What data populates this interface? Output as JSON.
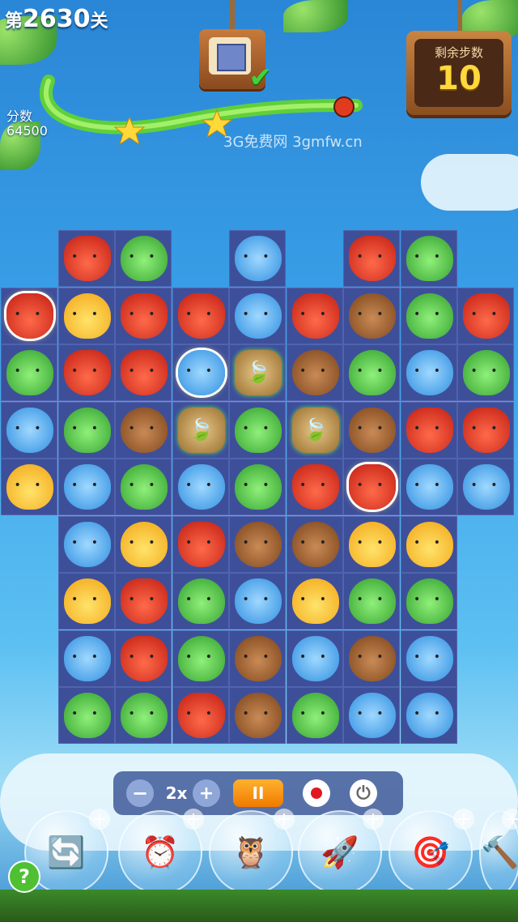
{
  "header": {
    "level_prefix": "第",
    "level_number": "2630",
    "level_suffix": "关",
    "score_label": "分数",
    "score_value": "64500",
    "stars_earned": 2,
    "goal_completed": true,
    "moves_label": "剩余步数",
    "moves_value": "10",
    "watermark": "3G免费网 3gmfw.cn"
  },
  "board": {
    "rows": [
      [
        null,
        "fox",
        "frog",
        null,
        "hippo",
        null,
        "fox",
        "frog",
        null
      ],
      [
        "fox",
        "chick",
        "fox",
        "fox",
        "hippo",
        "fox",
        "bear",
        "frog",
        "fox"
      ],
      [
        "frog",
        "fox",
        "fox",
        "hippo",
        "leafstone",
        "bear",
        "frog",
        "hippo",
        "frog"
      ],
      [
        "hippo",
        "frog",
        "bear",
        "leafstone",
        "frog",
        "leafstone",
        "bear",
        "fox",
        "fox"
      ],
      [
        "chick",
        "hippo",
        "frog",
        "hippo",
        "frog",
        "fox",
        "fox",
        "hippo",
        "hippo"
      ],
      [
        null,
        "hippo",
        "chick",
        "fox",
        "bear",
        "bear",
        "chick",
        "chick",
        null
      ],
      [
        null,
        "chick",
        "fox",
        "frog",
        "hippo",
        "chick",
        "frog",
        "frog",
        null
      ],
      [
        null,
        "hippo",
        "fox",
        "frog",
        "bear",
        "hippo",
        "bear",
        "hippo",
        null
      ],
      [
        null,
        "frog",
        "frog",
        "fox",
        "bear",
        "frog",
        "hippo",
        "hippo",
        null
      ]
    ],
    "highlighted": [
      [
        1,
        0
      ],
      [
        2,
        3
      ],
      [
        4,
        6
      ]
    ]
  },
  "controls": {
    "minus_label": "−",
    "speed_label": "2x",
    "plus_label": "+",
    "pause_label": "II",
    "power_label": "⏻"
  },
  "boosters": [
    {
      "name": "shuffle-booster",
      "icon": "🔄"
    },
    {
      "name": "time-booster",
      "icon": "⏰"
    },
    {
      "name": "swap-booster",
      "icon": "🦉"
    },
    {
      "name": "rocket-booster",
      "icon": "🚀"
    },
    {
      "name": "missile-booster",
      "icon": "🎯"
    },
    {
      "name": "hammer-booster",
      "icon": "🔨"
    }
  ],
  "help_label": "?"
}
